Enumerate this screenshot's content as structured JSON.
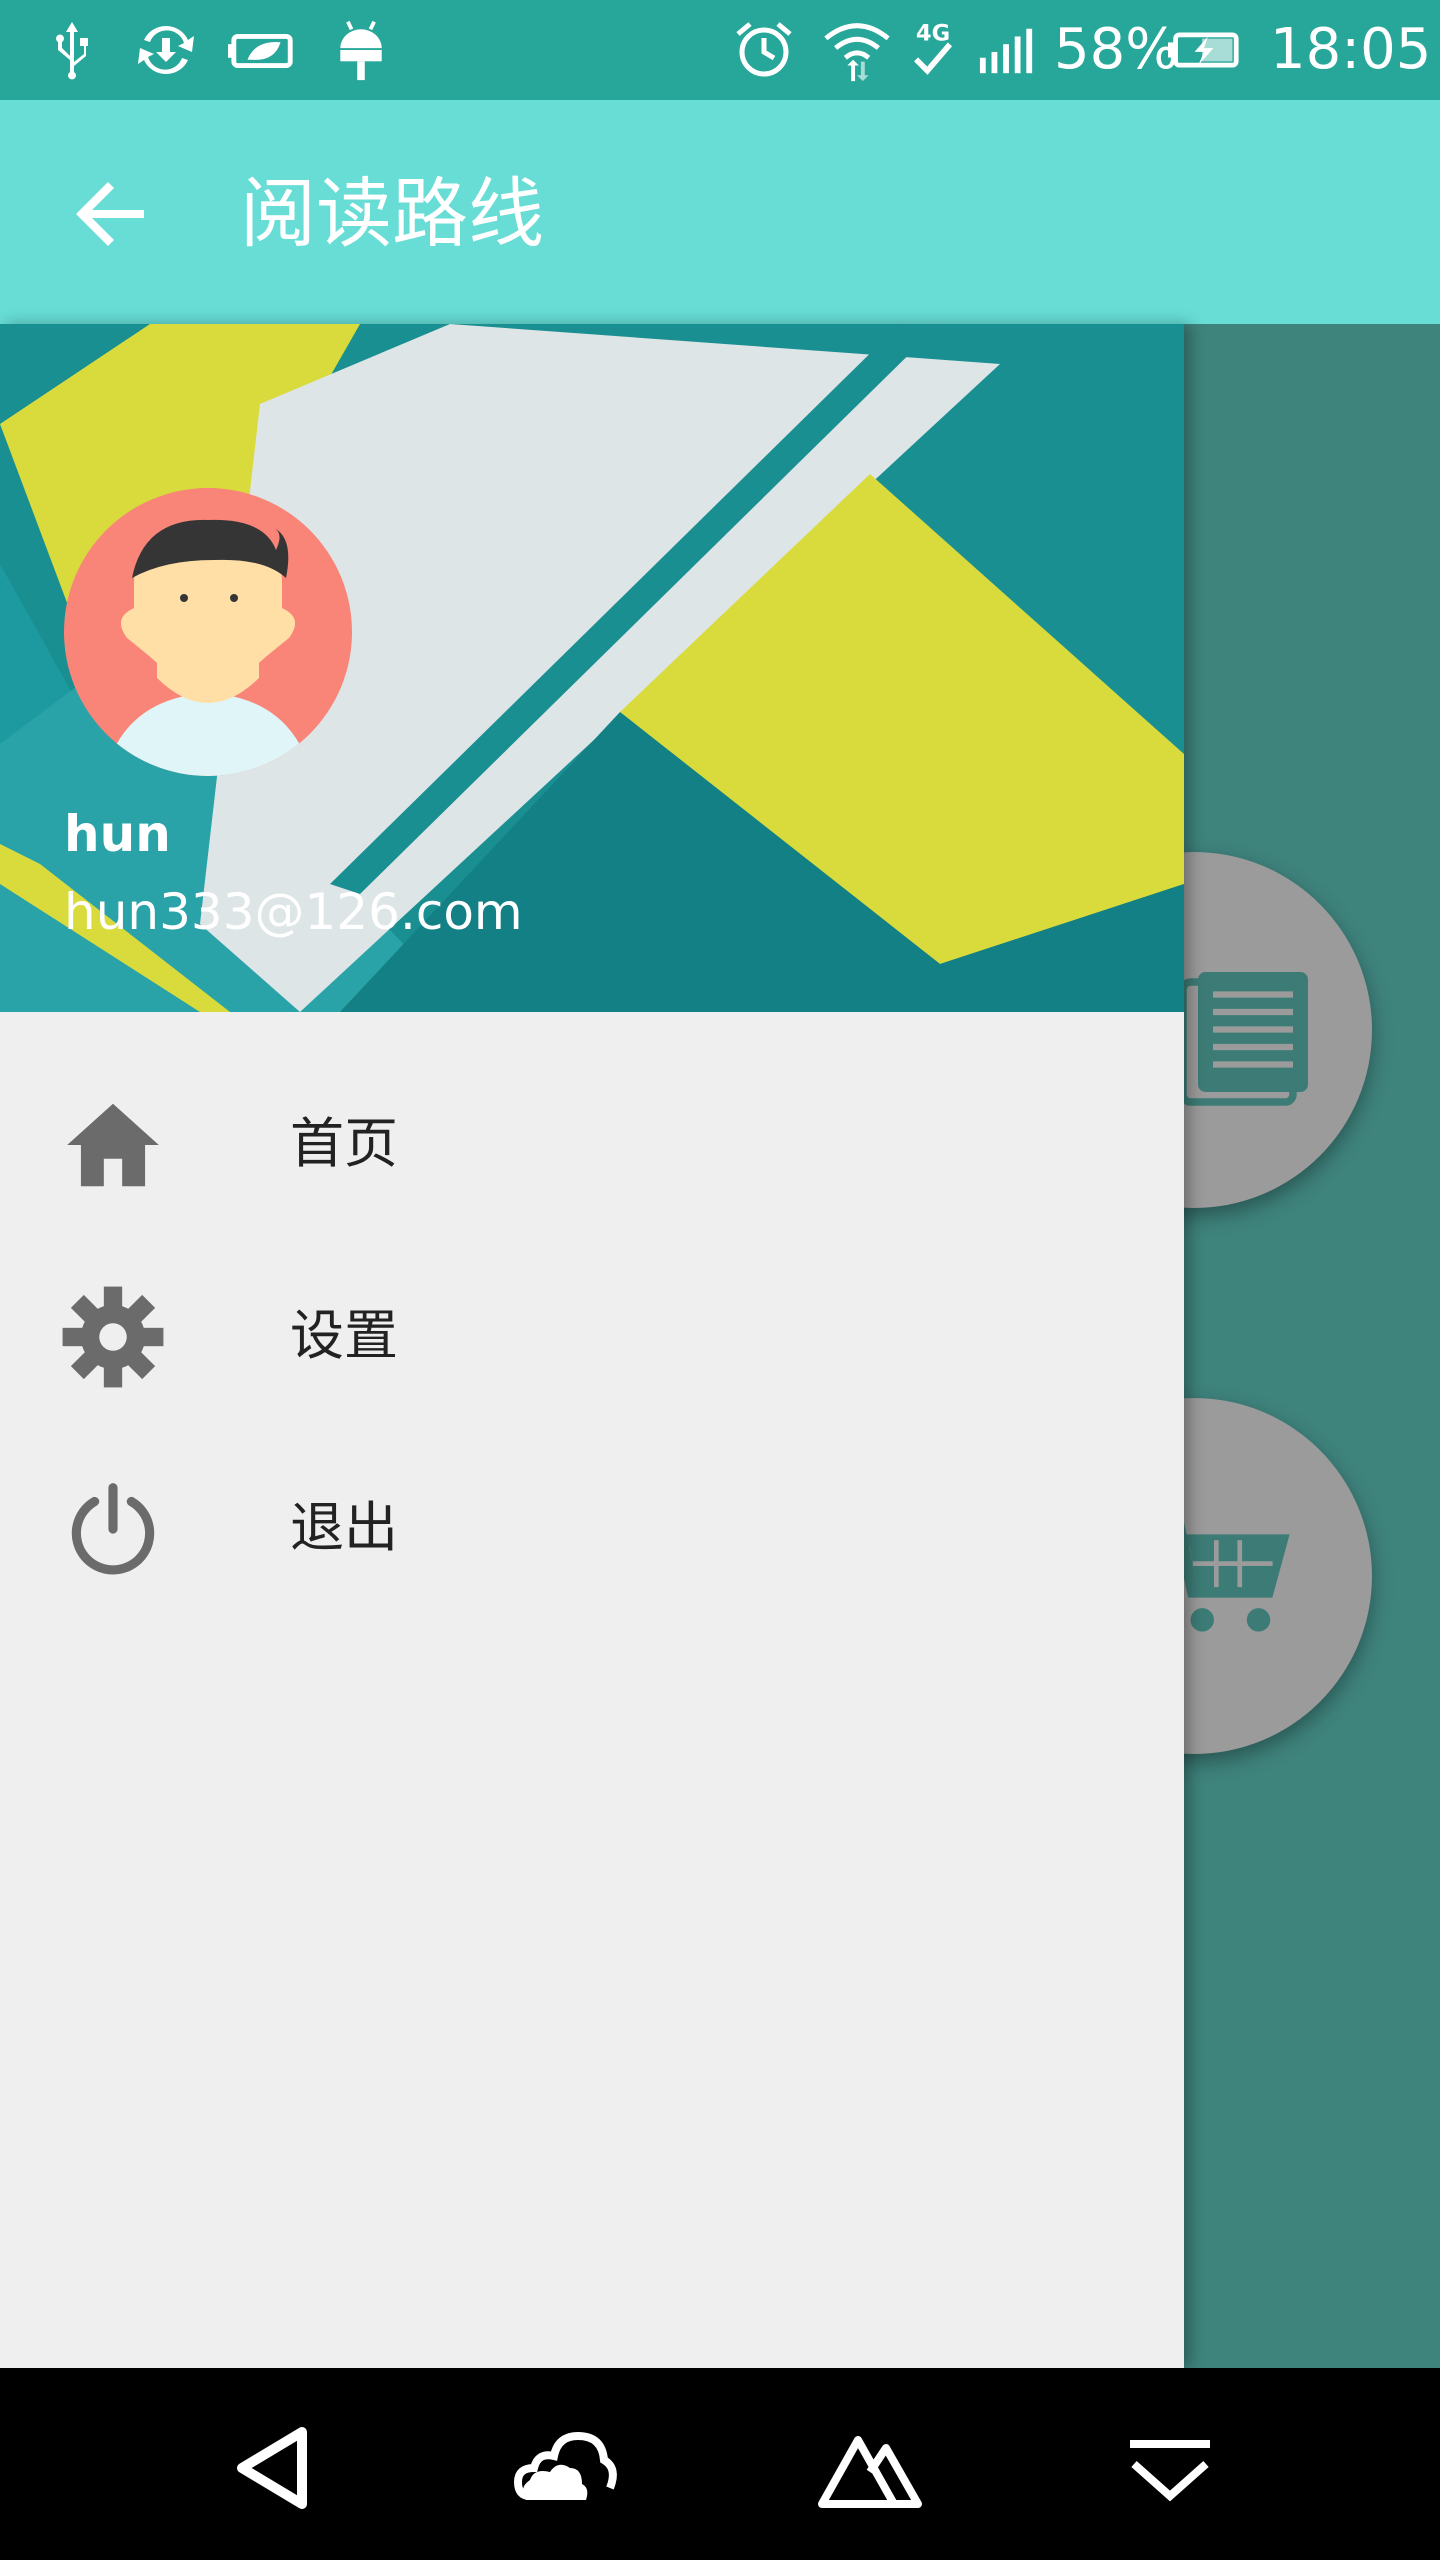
{
  "status_bar": {
    "battery": "58%",
    "time": "18:05",
    "network": "4G",
    "icons": [
      "usb-icon",
      "sync-icon",
      "battery-saver-icon",
      "android-debug-icon",
      "alarm-icon",
      "wifi-icon",
      "network-4g-icon",
      "signal-icon",
      "battery-charging-icon"
    ]
  },
  "app_bar": {
    "title": "阅读路线",
    "back_icon": "arrow-back-icon"
  },
  "drawer": {
    "user_name": "hun",
    "user_email": "hun333@126.com",
    "menu": [
      {
        "label": "首页",
        "icon": "home-icon"
      },
      {
        "label": "设置",
        "icon": "gear-icon"
      },
      {
        "label": "退出",
        "icon": "power-icon"
      }
    ]
  },
  "background_fabs": [
    "book-icon",
    "shopping-cart-icon"
  ],
  "nav_bar": [
    "back-triangle-icon",
    "cloud-icon",
    "mountain-icon",
    "collapse-icon"
  ],
  "colors": {
    "status_bar": "#27a79a",
    "app_bar": "#67ddd6",
    "drawer_bg": "#efefef",
    "scrim": "#3f837d",
    "accent_yellow": "#d7da3c"
  }
}
